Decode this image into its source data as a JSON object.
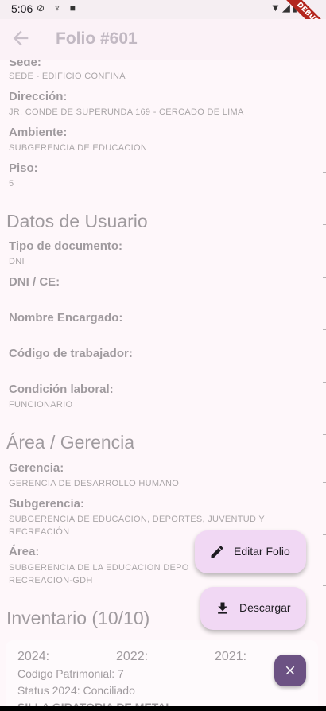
{
  "status_bar": {
    "time": "5:06",
    "ribbon": "DEBUG"
  },
  "app_bar": {
    "title": "Folio #601"
  },
  "fields_top": [
    {
      "label": "Sede:",
      "value": "SEDE - EDIFICIO CONFINA"
    },
    {
      "label": "Dirección:",
      "value": "JR. CONDE DE SUPERUNDA 169 - CERCADO DE LIMA"
    },
    {
      "label": "Ambiente:",
      "value": "SUBGERENCIA DE EDUCACION"
    },
    {
      "label": "Piso:",
      "value": "5"
    }
  ],
  "section_usuario": "Datos de Usuario",
  "fields_usuario": [
    {
      "label": "Tipo de documento:",
      "value": "DNI"
    },
    {
      "label": "DNI / CE:",
      "value": ""
    },
    {
      "label": "Nombre Encargado:",
      "value": ""
    },
    {
      "label": "Código de trabajador:",
      "value": ""
    },
    {
      "label": "Condición laboral:",
      "value": "FUNCIONARIO"
    }
  ],
  "section_area": "Área / Gerencia",
  "fields_area": [
    {
      "label": "Gerencia:",
      "value": "GERENCIA DE DESARROLLO HUMANO"
    },
    {
      "label": "Subgerencia:",
      "value": "SUBGERENCIA DE EDUCACION, DEPORTES, JUVENTUD Y",
      "value2": "RECREACIÓN"
    },
    {
      "label": "Área:",
      "value": "SUBGERENCIA DE LA EDUCACION DEPO",
      "value2": "RECREACION-GDH"
    }
  ],
  "section_inventario": "Inventario (10/10)",
  "inventory_card": {
    "year_2024": "2024:",
    "year_2022": "2022:",
    "year_2021": "2021:",
    "codigo": "Codigo Patrimonial: 7",
    "status": "Status 2024: Conciliado",
    "item": "SILLA GIRATORIA DE METAL"
  },
  "fab": {
    "edit_label": "Editar Folio",
    "download_label": "Descargar"
  },
  "colors": {
    "accent": "#6c5283",
    "fab_bg": "#f1d8f4",
    "background": "#fef7fa"
  }
}
